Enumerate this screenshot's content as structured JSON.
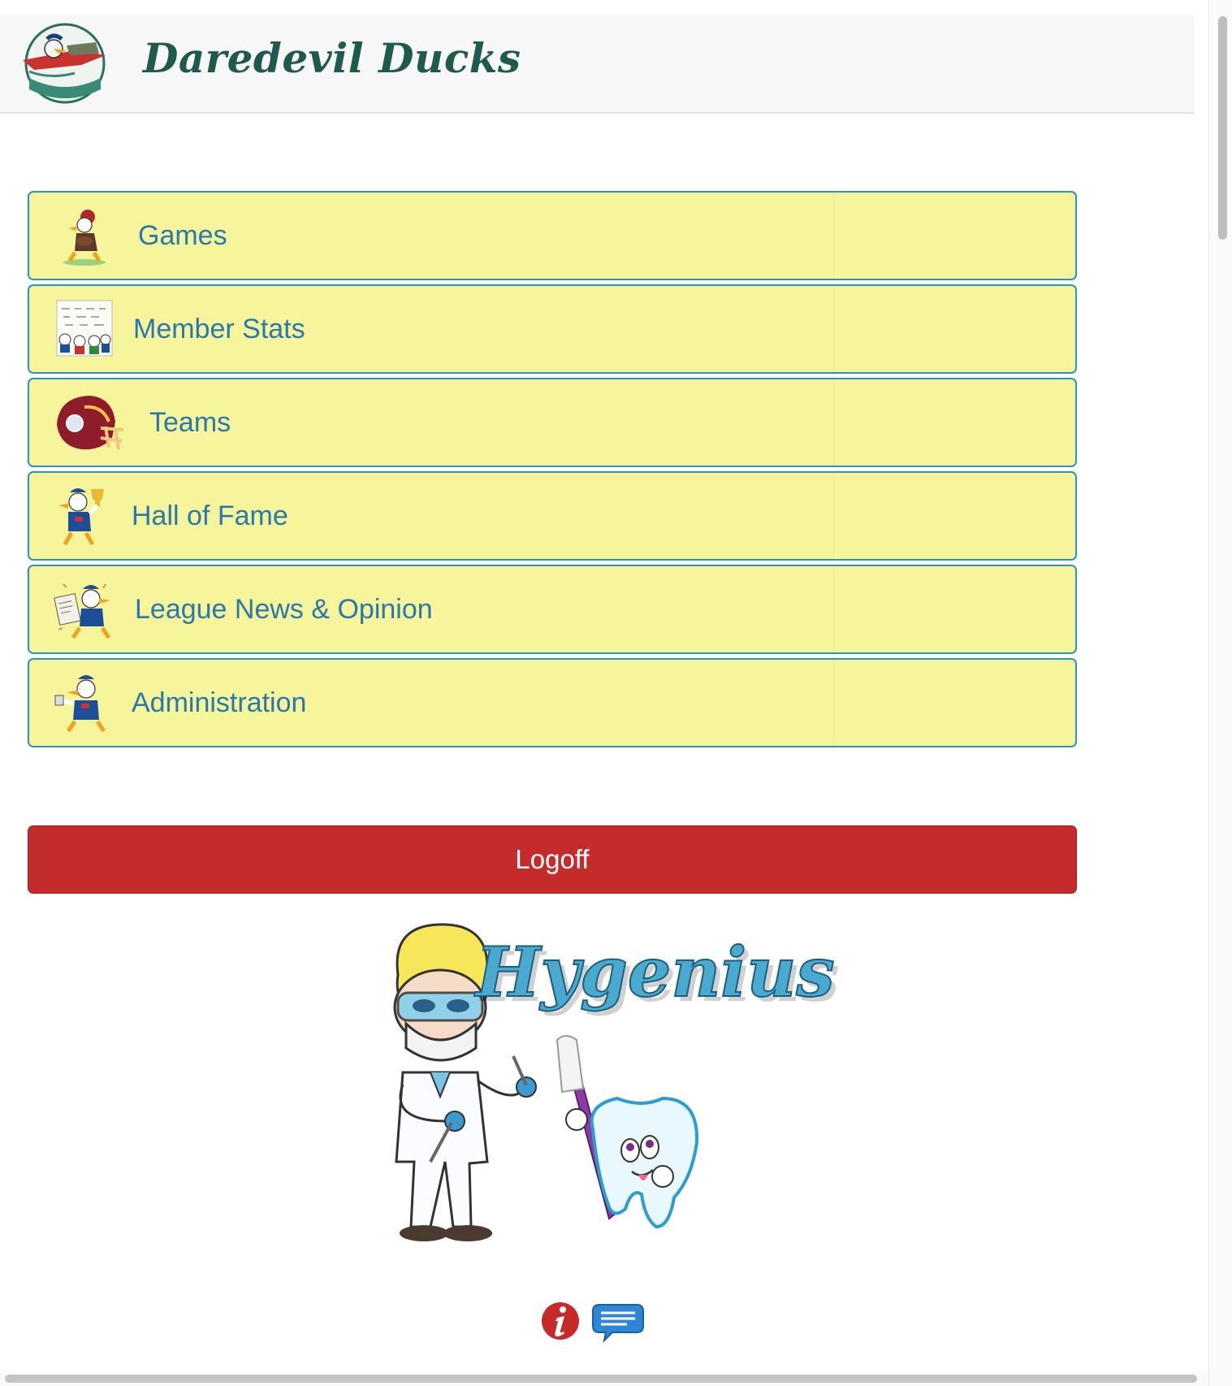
{
  "site": {
    "title": "Daredevil Ducks"
  },
  "menu": {
    "items": [
      {
        "label": "Games",
        "icon": "duck-football-player-icon"
      },
      {
        "label": "Member Stats",
        "icon": "ducks-chalkboard-icon"
      },
      {
        "label": "Teams",
        "icon": "football-helmet-icon"
      },
      {
        "label": "Hall of Fame",
        "icon": "duck-trophy-icon"
      },
      {
        "label": "League News & Opinion",
        "icon": "duck-newspaper-icon"
      },
      {
        "label": "Administration",
        "icon": "duck-admin-icon"
      }
    ]
  },
  "logoff": {
    "label": "Logoff"
  },
  "sponsor": {
    "name": "Hygenius"
  },
  "footer": {
    "icons": [
      "info-icon",
      "chat-icon"
    ]
  },
  "colors": {
    "menu_bg": "#f6f59c",
    "menu_border": "#2a95bd",
    "menu_text": "#2a78ad",
    "logoff_bg": "#c42b2b",
    "title": "#1f5a4e"
  }
}
